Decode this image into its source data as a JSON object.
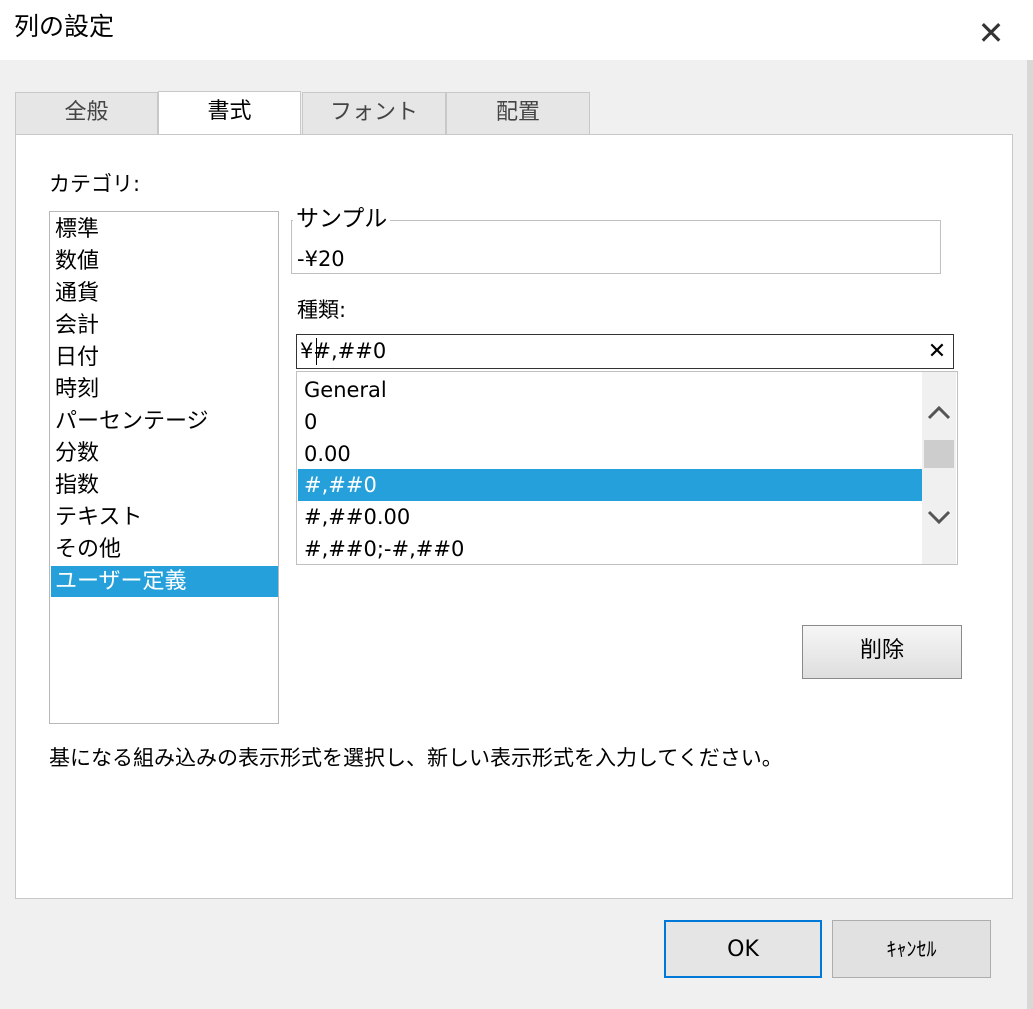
{
  "window": {
    "title": "列の設定"
  },
  "tabs": [
    {
      "label": "全般"
    },
    {
      "label": "書式"
    },
    {
      "label": "フォント"
    },
    {
      "label": "配置"
    }
  ],
  "category": {
    "label": "カテゴリ:",
    "items": [
      "標準",
      "数値",
      "通貨",
      "会計",
      "日付",
      "時刻",
      "パーセンテージ",
      "分数",
      "指数",
      "テキスト",
      "その他",
      "ユーザー定義"
    ],
    "selected": "ユーザー定義"
  },
  "sample": {
    "legend": "サンプル",
    "value": "-¥20"
  },
  "type": {
    "label": "種類:",
    "value": "¥#,##0",
    "items": [
      "General",
      "0",
      "0.00",
      "#,##0",
      "#,##0.00",
      "#,##0;-#,##0"
    ],
    "selected": "#,##0"
  },
  "buttons": {
    "delete": "削除",
    "ok": "OK",
    "cancel": "ｷｬﾝｾﾙ"
  },
  "description": "基になる組み込みの表示形式を選択し、新しい表示形式を入力してください。",
  "icons": {
    "close": "close-icon",
    "clear": "clear-icon",
    "scroll_up": "chevron-up-icon",
    "scroll_down": "chevron-down-icon"
  },
  "colors": {
    "selection": "#26a0da",
    "default_button_border": "#0078d7"
  }
}
